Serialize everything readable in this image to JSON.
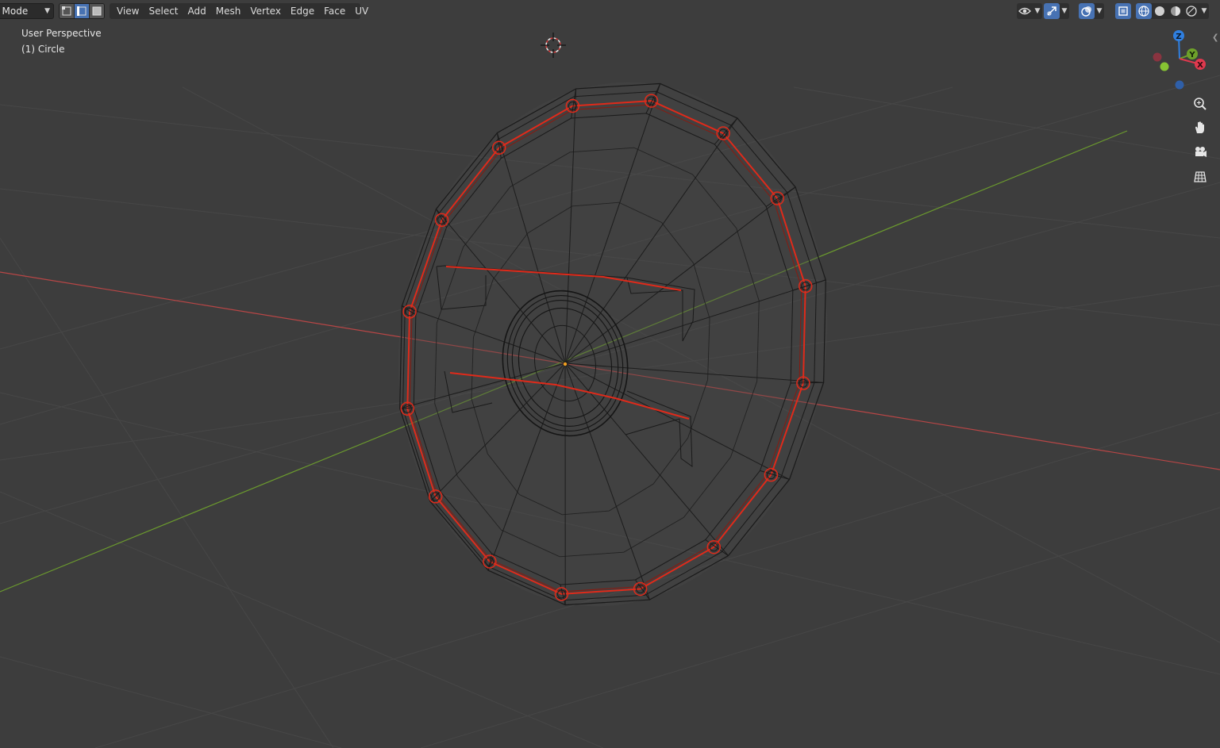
{
  "header": {
    "mode_label": "t Mode",
    "select_modes": [
      "vertex-select",
      "edge-select",
      "face-select"
    ],
    "active_select_mode": "edge-select",
    "menus": [
      "View",
      "Select",
      "Add",
      "Mesh",
      "Vertex",
      "Edge",
      "Face",
      "UV"
    ]
  },
  "viewport": {
    "perspective_label": "User Perspective",
    "object_label": "(1) Circle"
  },
  "gizmo": {
    "axes": [
      {
        "label": "Z",
        "color": "#2f7fe0"
      },
      {
        "label": "Y",
        "color": "#6ea12a"
      },
      {
        "label": "X",
        "color": "#e0394e"
      }
    ]
  },
  "nav_tools": [
    "zoom-icon",
    "hand-pan-icon",
    "camera-icon",
    "ortho-grid-icon"
  ],
  "colors": {
    "background": "#3d3d3d",
    "x_axis": "#b84646",
    "y_axis": "#6b9a2e",
    "selected_edge": "#e02a1a",
    "wire": "#1a1a1a",
    "active_button": "#4772b3"
  }
}
